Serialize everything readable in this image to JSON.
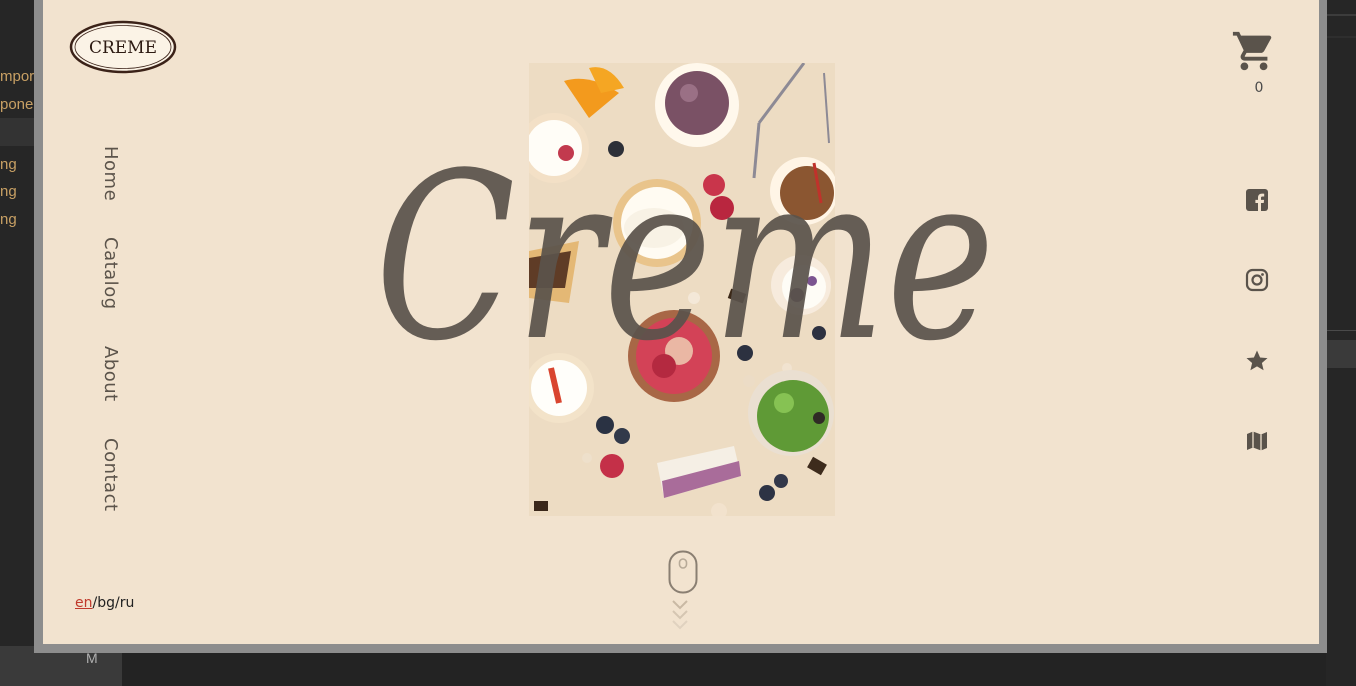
{
  "background_editor": {
    "lines": [
      "mpor",
      "poner",
      "ng",
      "ng",
      "ng"
    ],
    "bottom_tab": "M"
  },
  "site": {
    "logo_text": "CREME",
    "hero_script": "Creme",
    "nav": [
      {
        "label": "Home"
      },
      {
        "label": "Catalog"
      },
      {
        "label": "About"
      },
      {
        "label": "Contact"
      }
    ],
    "lang": {
      "active": "en",
      "sep1": "/",
      "opt2": "bg",
      "sep2": "/",
      "opt3": "ru"
    },
    "cart": {
      "count": "0",
      "icon": "cart-icon"
    },
    "social_icons": [
      "facebook-icon",
      "instagram-icon",
      "star-icon",
      "map-icon"
    ],
    "colors": {
      "page_bg": "#f2e3cf",
      "text_dark": "#5c544b",
      "accent_red": "#c0392b"
    }
  }
}
